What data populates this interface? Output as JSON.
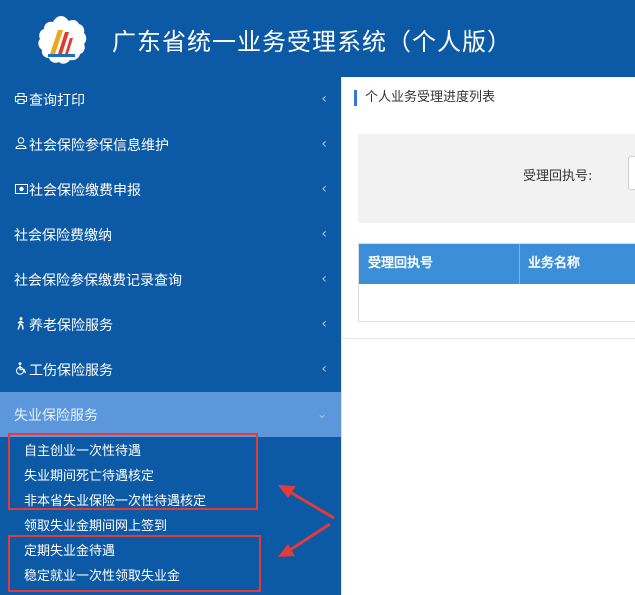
{
  "header": {
    "title": "广东省统一业务受理系统（个人版）"
  },
  "sidebar": {
    "items": [
      {
        "label": "查询打印",
        "icon": "printer-icon"
      },
      {
        "label": "社会保险参保信息维护",
        "icon": "user-icon"
      },
      {
        "label": "社会保险缴费申报",
        "icon": "money-icon"
      },
      {
        "label": "社会保险费缴纳",
        "icon": ""
      },
      {
        "label": "社会保险参保缴费记录查询",
        "icon": ""
      },
      {
        "label": "养老保险服务",
        "icon": "person-walking-icon"
      },
      {
        "label": "工伤保险服务",
        "icon": "wheelchair-icon"
      },
      {
        "label": "失业保险服务",
        "icon": "",
        "expanded": true
      }
    ],
    "submenu": [
      "自主创业一次性待遇",
      "失业期间死亡待遇核定",
      "非本省失业保险一次性待遇核定",
      "领取失业金期间网上签到",
      "定期失业金待遇",
      "稳定就业一次性领取失业金"
    ]
  },
  "main": {
    "panel_title": "个人业务受理进度列表",
    "search_label": "受理回执号:",
    "table_headers": [
      "受理回执号",
      "业务名称"
    ]
  },
  "colors": {
    "brand": "#0c5aa6",
    "active_item": "#5b97da",
    "table_header": "#3b8ed7",
    "annotation": "#e33a3a"
  }
}
